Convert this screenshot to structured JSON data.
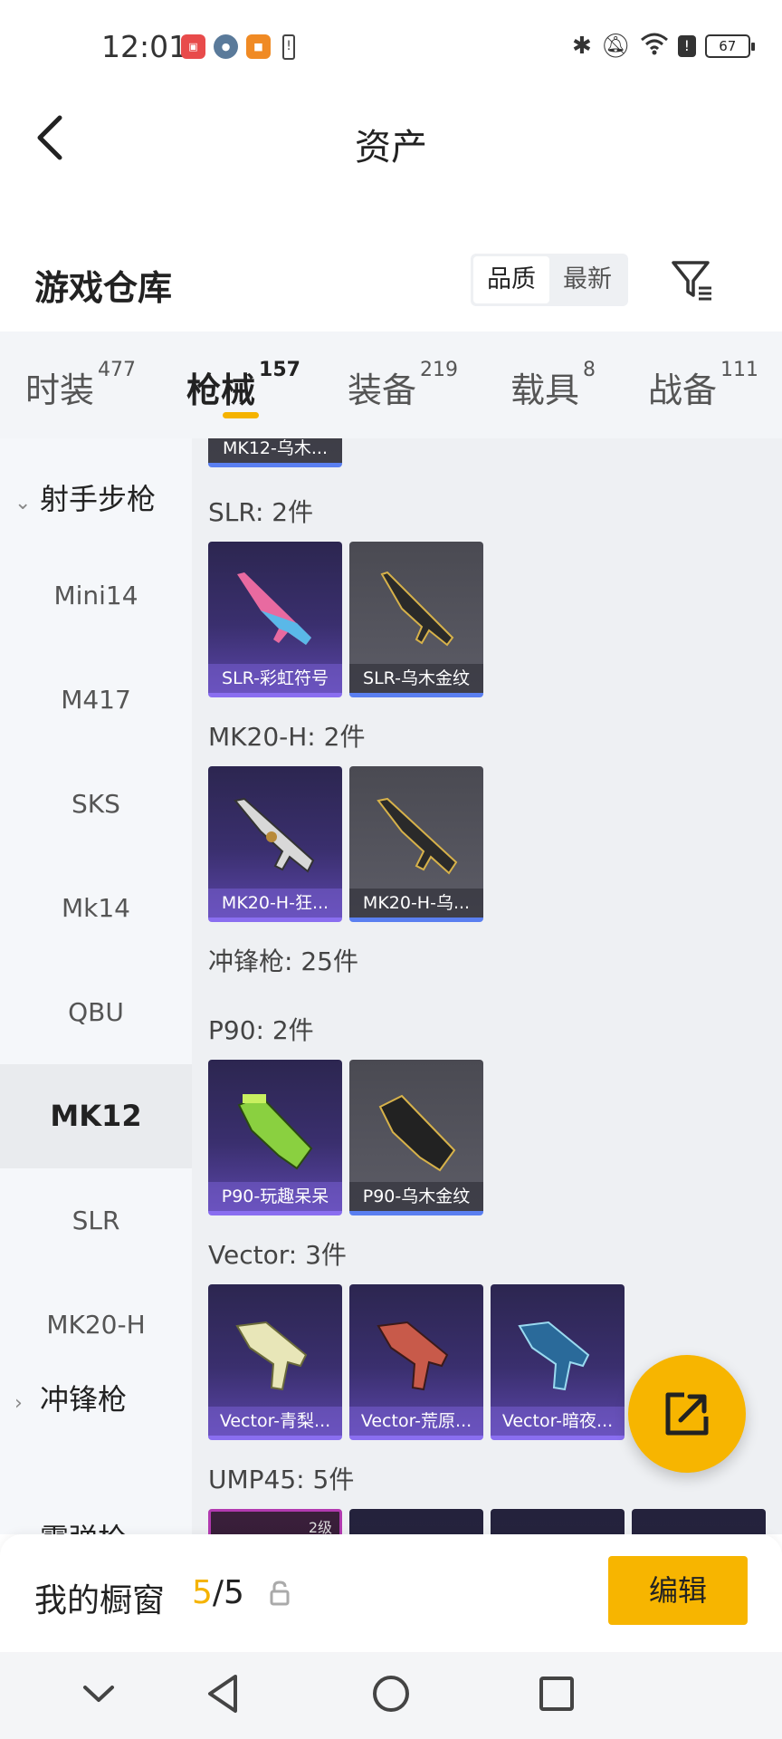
{
  "status_bar": {
    "time": "12:01",
    "battery": "67",
    "app_icons": [
      "huawei-app-icon",
      "game-app-icon",
      "orange-app-icon",
      "battery-alert-icon"
    ],
    "right_icons": [
      "bluetooth-icon",
      "mute-icon",
      "wifi-icon",
      "alert-icon"
    ]
  },
  "header": {
    "title": "资产",
    "section_title": "游戏仓库",
    "sort_options": [
      "品质",
      "最新"
    ],
    "sort_selected": "品质"
  },
  "tabs": [
    {
      "label": "时装",
      "count": "477"
    },
    {
      "label": "枪械",
      "count": "157",
      "active": true
    },
    {
      "label": "装备",
      "count": "219"
    },
    {
      "label": "载具",
      "count": "8"
    },
    {
      "label": "战备",
      "count": "111"
    }
  ],
  "sidebar": {
    "category_1": "射手步枪",
    "items": [
      "Mini14",
      "M417",
      "SKS",
      "Mk14",
      "QBU",
      "MK12",
      "SLR",
      "MK20-H"
    ],
    "active_item": "MK12",
    "category_2": "冲锋枪",
    "category_3": "霰弹枪"
  },
  "content": {
    "top_partial_label": "MK12-乌木...",
    "sections": {
      "slr": {
        "title": "SLR: 2件",
        "cards": [
          "SLR-彩虹符号",
          "SLR-乌木金纹"
        ]
      },
      "mk20h": {
        "title": "MK20-H: 2件",
        "cards": [
          "MK20-H-狂...",
          "MK20-H-乌..."
        ]
      },
      "smg_header": "冲锋枪: 25件",
      "p90": {
        "title": "P90: 2件",
        "cards": [
          "P90-玩趣呆呆",
          "P90-乌木金纹"
        ]
      },
      "vector": {
        "title": "Vector: 3件",
        "cards": [
          "Vector-青梨...",
          "Vector-荒原...",
          "Vector-暗夜..."
        ]
      },
      "ump45": {
        "title": "UMP45: 5件",
        "first_badge": "2级"
      }
    }
  },
  "bottom_bar": {
    "showcase_label": "我的橱窗",
    "showcase_current": "5",
    "showcase_sep": "/",
    "showcase_total": "5",
    "edit_label": "编辑"
  },
  "colors": {
    "accent": "#f7b500",
    "purple_card": "#5a45a8",
    "gray_card": "#5c5c66"
  }
}
